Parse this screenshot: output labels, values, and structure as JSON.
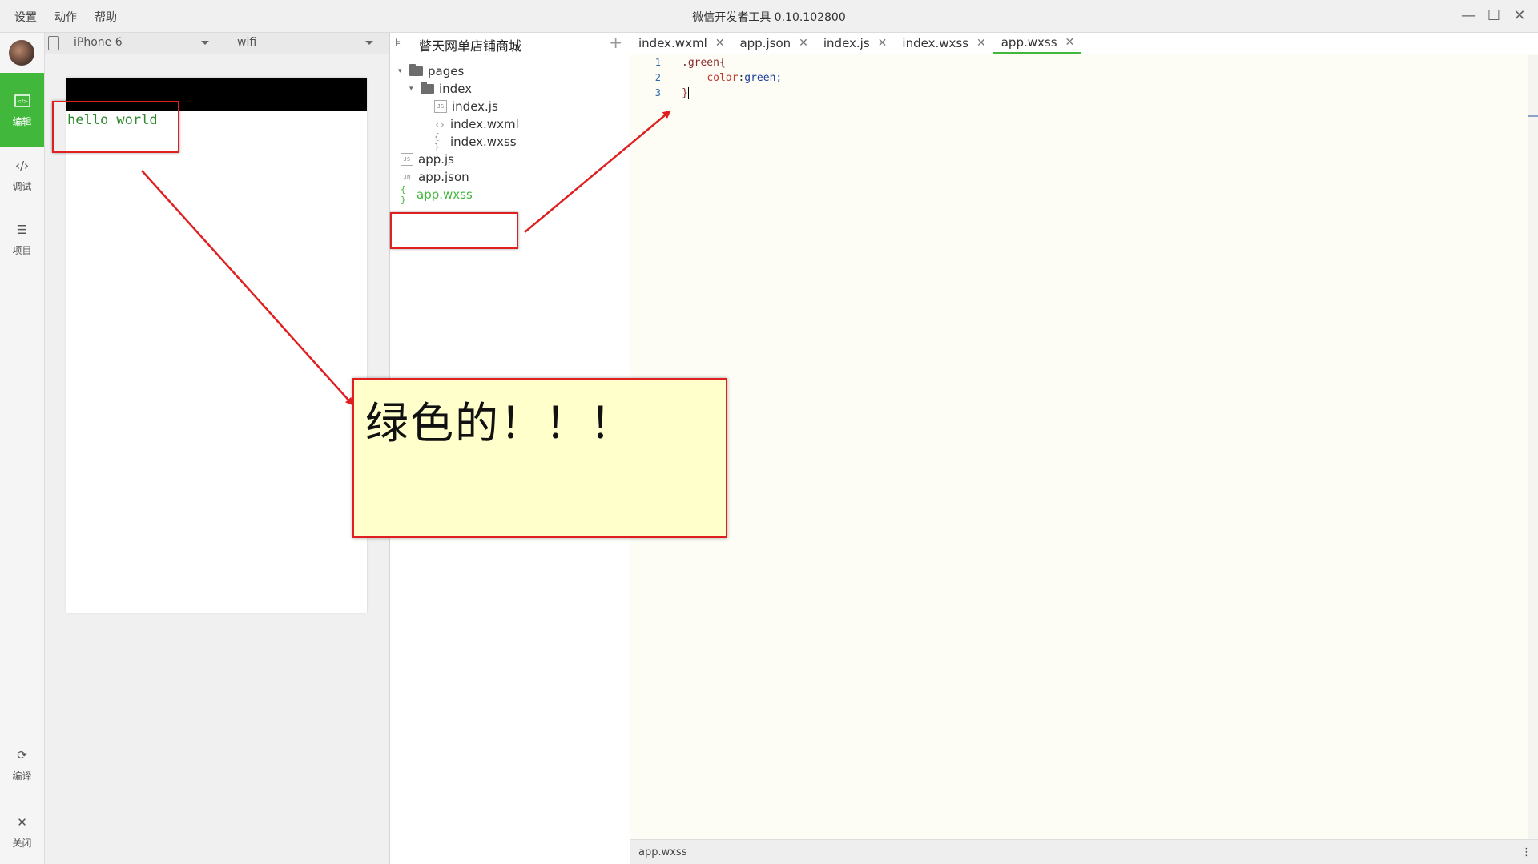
{
  "menu": [
    "设置",
    "动作",
    "帮助"
  ],
  "app_title": "微信开发者工具 0.10.102800",
  "sidebar": {
    "items": [
      {
        "label": "编辑",
        "icon": "code-box-icon"
      },
      {
        "label": "调试",
        "icon": "code-brackets-icon"
      },
      {
        "label": "项目",
        "icon": "list-icon"
      },
      {
        "label": "编译",
        "icon": "compile-icon"
      },
      {
        "label": "关闭",
        "icon": "close-icon"
      }
    ]
  },
  "device": {
    "model": "iPhone 6",
    "network": "wifi"
  },
  "simulator": {
    "text": "hello world"
  },
  "project": {
    "name": "瞥天网单店铺商城",
    "tree": {
      "pages": "pages",
      "index": "index",
      "index_js": "index.js",
      "index_wxml": "index.wxml",
      "index_wxss": "index.wxss",
      "app_js": "app.js",
      "app_json": "app.json",
      "app_wxss": "app.wxss"
    }
  },
  "editor": {
    "tabs": [
      {
        "label": "index.wxml"
      },
      {
        "label": "app.json"
      },
      {
        "label": "index.js"
      },
      {
        "label": "index.wxss"
      },
      {
        "label": "app.wxss",
        "active": true
      }
    ],
    "line_numbers": [
      "1",
      "2",
      "3"
    ],
    "code": {
      "selector": ".green{",
      "prop": "color",
      "value": "green;",
      "close": "}"
    },
    "status_file": "app.wxss"
  },
  "annotation": {
    "note": "绿色的！！！"
  },
  "colors": {
    "accent_green": "#41b83b",
    "annotation_red": "#e02020",
    "note_bg": "#ffffcc"
  }
}
